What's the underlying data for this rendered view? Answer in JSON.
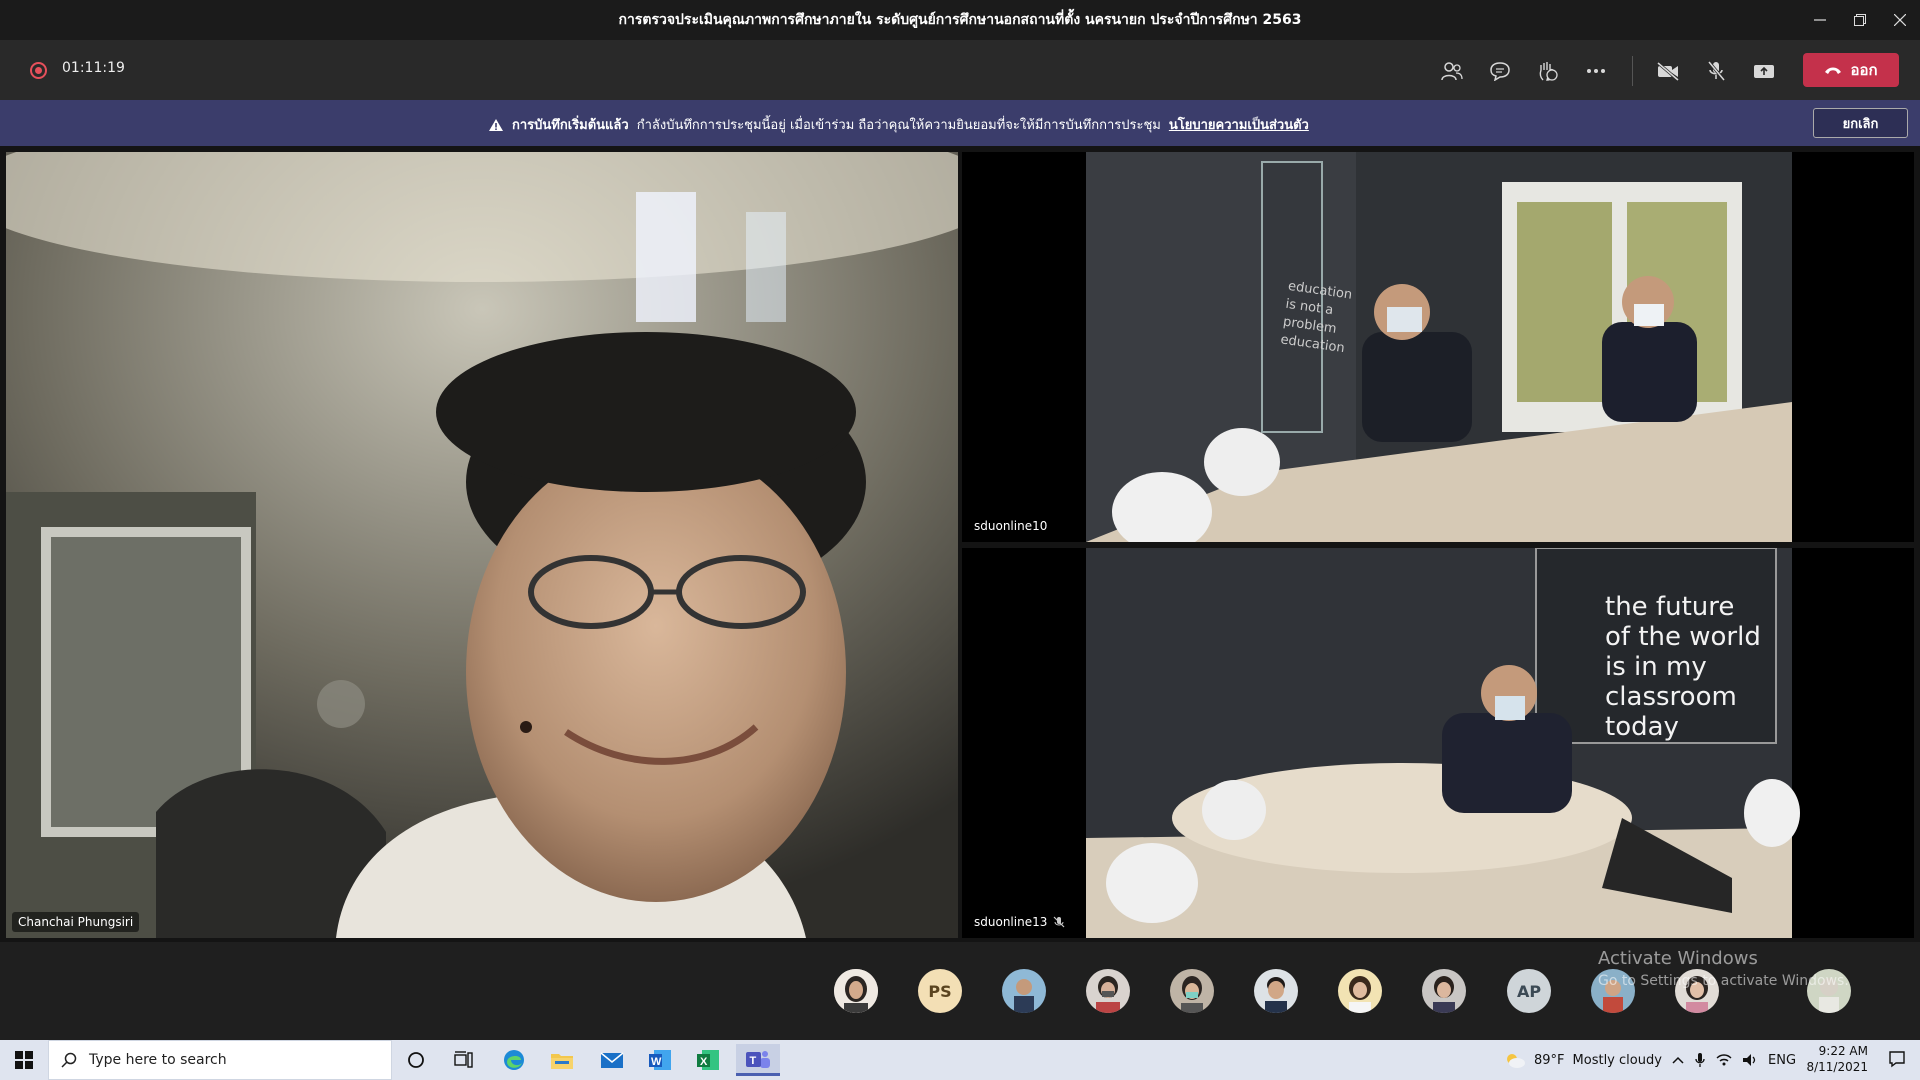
{
  "window": {
    "title": "การตรวจประเมินคุณภาพการศึกษาภายใน ระดับศูนย์การศึกษานอกสถานที่ตั้ง นครนายก ประจำปีการศึกษา 2563"
  },
  "toolbar": {
    "timer": "01:11:19",
    "leave_label": "ออก"
  },
  "banner": {
    "heading": "การบันทึกเริ่มต้นแล้ว",
    "message": "กำลังบันทึกการประชุมนี้อยู่ เมื่อเข้าร่วม ถือว่าคุณให้ความยินยอมที่จะให้มีการบันทึกการประชุม",
    "link": "นโยบายความเป็นส่วนตัว",
    "cancel_label": "ยกเลิก"
  },
  "tiles": {
    "main_name": "Chanchai Phungsiri",
    "top_right_name": "sduonline10",
    "bottom_right_name": "sduonline13",
    "wall_text_top": [
      "education",
      "is not a",
      "problem",
      "education"
    ],
    "wall_text_bottom": [
      "the future",
      "of the world",
      "is in my",
      "classroom",
      "today"
    ],
    "overlay_initials": "AP"
  },
  "participants": {
    "initials_ps": "PS",
    "initials_ap": "AP"
  },
  "watermark": {
    "line1": "Activate Windows",
    "line2": "Go to Settings to activate Windows."
  },
  "taskbar": {
    "search_placeholder": "Type here to search",
    "weather_temp": "89°F",
    "weather_desc": "Mostly cloudy",
    "lang": "ENG",
    "time": "9:22 AM",
    "date": "8/11/2021"
  },
  "colors": {
    "leave": "#c4314b",
    "banner": "#3b3d6b",
    "recording": "#e6505b"
  }
}
